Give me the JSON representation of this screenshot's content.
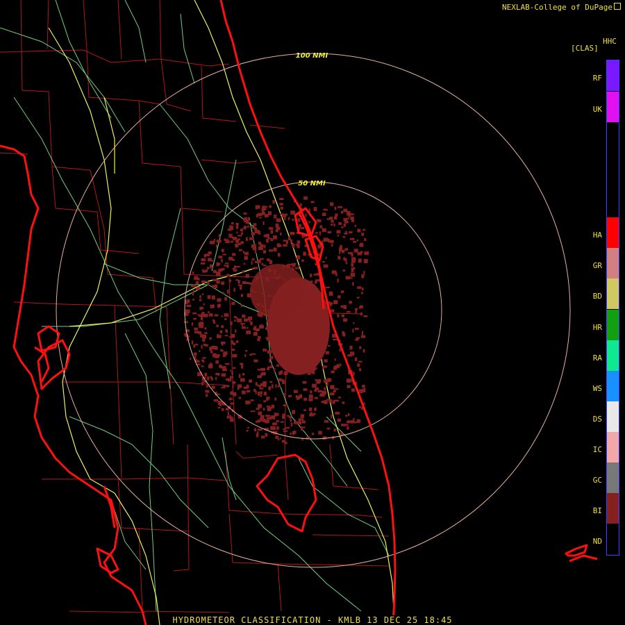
{
  "header": {
    "credit": "NEXLAB-College of DuPage"
  },
  "legend": {
    "product_code": "HHC",
    "units": "[CLAS]",
    "classes": [
      {
        "code": "RF",
        "color": "#7a18ff"
      },
      {
        "code": "UK",
        "color": "#e010f0"
      },
      {
        "code": "HA",
        "color": "#ff0000"
      },
      {
        "code": "GR",
        "color": "#d08080"
      },
      {
        "code": "BD",
        "color": "#d0c860"
      },
      {
        "code": "HR",
        "color": "#10a010"
      },
      {
        "code": "RA",
        "color": "#10e890"
      },
      {
        "code": "WS",
        "color": "#1890ff"
      },
      {
        "code": "DS",
        "color": "#e8e8e8"
      },
      {
        "code": "IC",
        "color": "#f0a8a8"
      },
      {
        "code": "GC",
        "color": "#787878"
      },
      {
        "code": "BI",
        "color": "#842020"
      },
      {
        "code": "ND",
        "color": "#000000"
      }
    ]
  },
  "map": {
    "range_rings": [
      "100 NMI",
      "50 NMI"
    ],
    "colors": {
      "coastline": "#ff1010",
      "county": "#b01818",
      "interstate": "#f0f060",
      "highway": "#70d080",
      "ring": "#e8b0a0",
      "echo": "#842020"
    }
  },
  "footer": {
    "product": "HYDROMETEOR CLASSIFICATION",
    "separator": "-",
    "station": "KMLB",
    "datetime": "13 DEC 25 18:45"
  }
}
